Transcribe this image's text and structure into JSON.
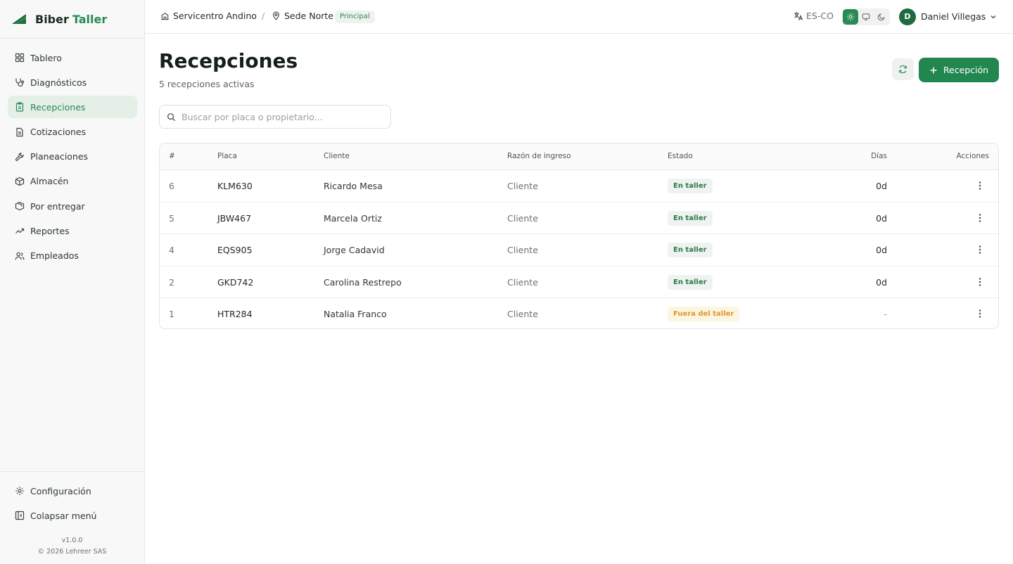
{
  "brand": {
    "name": "Biber",
    "accent": "Taller",
    "logo_icon": "boat-logo"
  },
  "sidebar": {
    "items": [
      {
        "label": "Tablero",
        "icon": "dashboard-icon"
      },
      {
        "label": "Diagnósticos",
        "icon": "stethoscope-icon"
      },
      {
        "label": "Recepciones",
        "icon": "clipboard-icon",
        "active": true
      },
      {
        "label": "Cotizaciones",
        "icon": "file-icon"
      },
      {
        "label": "Planeaciones",
        "icon": "wrench-icon"
      },
      {
        "label": "Almacén",
        "icon": "package-icon"
      },
      {
        "label": "Por entregar",
        "icon": "delivery-icon"
      },
      {
        "label": "Reportes",
        "icon": "trend-icon"
      },
      {
        "label": "Empleados",
        "icon": "users-icon"
      }
    ],
    "footer": {
      "settings_label": "Configuración",
      "collapse_label": "Colapsar menú",
      "version": "v1.0.0",
      "copyright": "© 2026 Lehreer SAS"
    }
  },
  "topbar": {
    "company": "Servicentro Andino",
    "separator": "/",
    "branch": "Sede Norte",
    "branch_badge": "Principal",
    "language": "ES-CO",
    "theme_modes": [
      "light",
      "system",
      "dark"
    ],
    "theme_active": "light",
    "user_initial": "D",
    "user_name": "Daniel Villegas"
  },
  "page": {
    "title": "Recepciones",
    "subtitle": "5 recepciones activas",
    "add_button_label": "Recepción",
    "search_placeholder": "Buscar por placa o propietario..."
  },
  "table": {
    "columns": [
      "#",
      "Placa",
      "Cliente",
      "Razón de ingreso",
      "Estado",
      "Días",
      "Acciones"
    ],
    "rows": [
      {
        "num": "6",
        "plate": "KLM630",
        "client": "Ricardo Mesa",
        "reason": "Cliente",
        "status": "En taller",
        "status_type": "in",
        "days": "0d"
      },
      {
        "num": "5",
        "plate": "JBW467",
        "client": "Marcela Ortiz",
        "reason": "Cliente",
        "status": "En taller",
        "status_type": "in",
        "days": "0d"
      },
      {
        "num": "4",
        "plate": "EQS905",
        "client": "Jorge Cadavid",
        "reason": "Cliente",
        "status": "En taller",
        "status_type": "in",
        "days": "0d"
      },
      {
        "num": "2",
        "plate": "GKD742",
        "client": "Carolina Restrepo",
        "reason": "Cliente",
        "status": "En taller",
        "status_type": "in",
        "days": "0d"
      },
      {
        "num": "1",
        "plate": "HTR284",
        "client": "Natalia Franco",
        "reason": "Cliente",
        "status": "Fuera del taller",
        "status_type": "out",
        "days": "-"
      }
    ]
  },
  "colors": {
    "primary": "#22874f",
    "accent_text": "#2a8a55",
    "active_bg": "#e4efe8",
    "warning_bg": "#fdf4e2",
    "warning_text": "#d99b2b"
  }
}
